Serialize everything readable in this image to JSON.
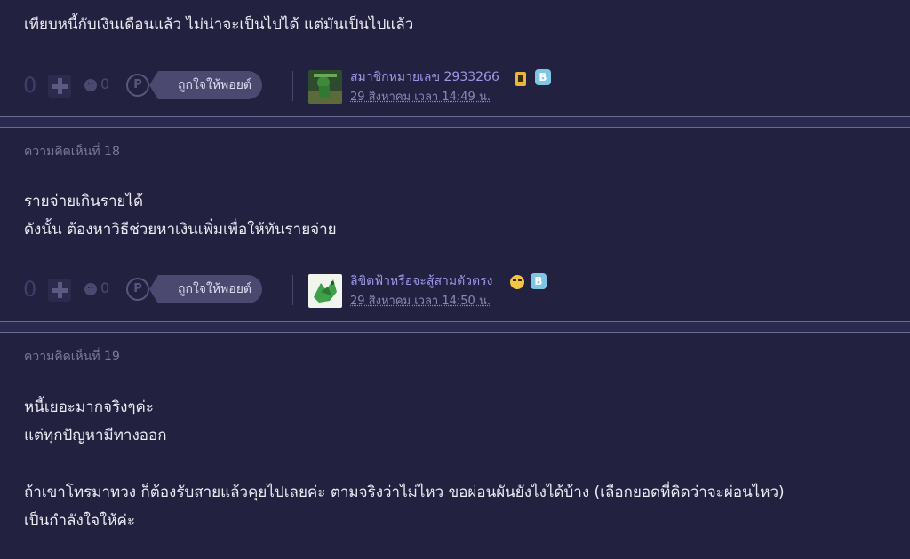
{
  "comments": [
    {
      "label": "",
      "text": "เทียบหนี้กับเงินเดือนแล้ว ไม่น่าจะเป็นไปได้  แต่มันเป็นไปแล้ว",
      "votes": "0",
      "sad_count": "0",
      "point_icon": "P",
      "like_label": "ถูกใจให้พอยต์",
      "username": "สมาชิกหมายเลข 2933266",
      "timestamp": "29 สิงหาคม เวลา 14:49 น.",
      "badges": [
        "mobile-badge-icon",
        "blog-badge-icon"
      ],
      "badge_b": "B"
    },
    {
      "label": "ความคิดเห็นที่ 18",
      "text": "รายจ่ายเกินรายได้\nดังนั้น ต้องหาวิธีช่วยหาเงินเพิ่มเพื่อให้ทันรายจ่าย",
      "votes": "0",
      "sad_count": "0",
      "point_icon": "P",
      "like_label": "ถูกใจให้พอยต์",
      "username": "ลิขิตฟ้าหรือจะสู้สามตัวตรง",
      "timestamp": "29 สิงหาคม เวลา 14:50 น.",
      "badges": [
        "laughing-emoji-icon",
        "blog-badge-icon"
      ],
      "badge_b": "B"
    },
    {
      "label": "ความคิดเห็นที่ 19",
      "text": "หนี้เยอะมากจริงๆค่ะ\nแต่ทุกปัญหามีทางออก\n\nถ้าเขาโทรมาทวง ก็ต้องรับสายแล้วคุยไปเลยค่ะ ตามจริงว่าไม่ไหว ขอผ่อนผันยังไงได้บ้าง (เลือกยอดที่คิดว่าจะผ่อนไหว)\nเป็นกำลังใจให้ค่ะ"
    }
  ],
  "colors": {
    "background": "#22213f",
    "username": "#9c97e8",
    "like_tag": "#4b4970"
  }
}
